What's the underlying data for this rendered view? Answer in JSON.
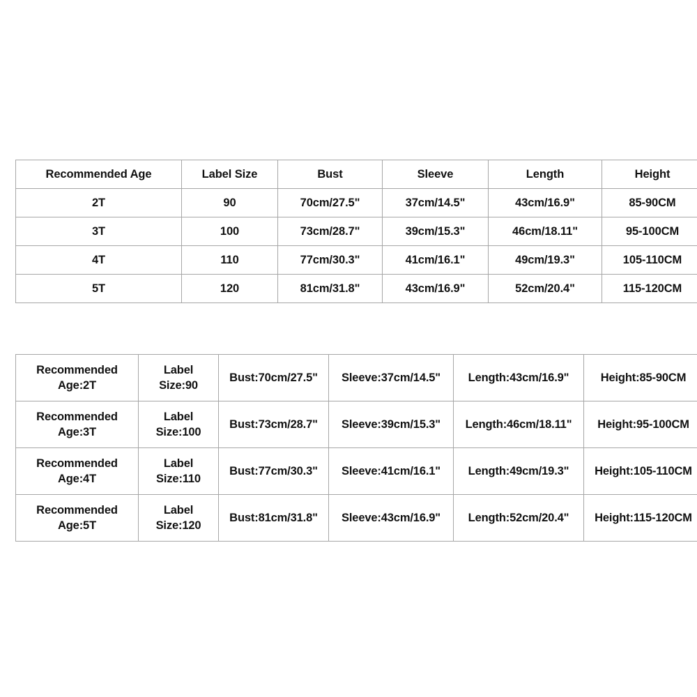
{
  "page": {
    "background_color": "#ffffff",
    "border_color": "#a6a6a6",
    "text_color": "#111111"
  },
  "table_columns": {
    "name": "size-chart-column-table",
    "headers": [
      "Recommended Age",
      "Label Size",
      "Bust",
      "Sleeve",
      "Length",
      "Height"
    ],
    "rows": [
      [
        "2T",
        "90",
        "70cm/27.5\"",
        "37cm/14.5\"",
        "43cm/16.9\"",
        "85-90CM"
      ],
      [
        "3T",
        "100",
        "73cm/28.7\"",
        "39cm/15.3\"",
        "46cm/18.11\"",
        "95-100CM"
      ],
      [
        "4T",
        "110",
        "77cm/30.3\"",
        "41cm/16.1\"",
        "49cm/19.3\"",
        "105-110CM"
      ],
      [
        "5T",
        "120",
        "81cm/31.8\"",
        "43cm/16.9\"",
        "52cm/20.4\"",
        "115-120CM"
      ]
    ]
  },
  "table_inline": {
    "name": "size-chart-inline-table",
    "rows": [
      {
        "age_line1": "Recommended",
        "age_line2": "Age:2T",
        "label_line1": "Label",
        "label_line2": "Size:90",
        "bust": "Bust:70cm/27.5\"",
        "sleeve": "Sleeve:37cm/14.5\"",
        "length": "Length:43cm/16.9\"",
        "height": "Height:85-90CM"
      },
      {
        "age_line1": "Recommended",
        "age_line2": "Age:3T",
        "label_line1": "Label",
        "label_line2": "Size:100",
        "bust": "Bust:73cm/28.7\"",
        "sleeve": "Sleeve:39cm/15.3\"",
        "length": "Length:46cm/18.11\"",
        "height": "Height:95-100CM"
      },
      {
        "age_line1": "Recommended",
        "age_line2": "Age:4T",
        "label_line1": "Label",
        "label_line2": "Size:110",
        "bust": "Bust:77cm/30.3\"",
        "sleeve": "Sleeve:41cm/16.1\"",
        "length": "Length:49cm/19.3\"",
        "height": "Height:105-110CM"
      },
      {
        "age_line1": "Recommended",
        "age_line2": "Age:5T",
        "label_line1": "Label",
        "label_line2": "Size:120",
        "bust": "Bust:81cm/31.8\"",
        "sleeve": "Sleeve:43cm/16.9\"",
        "length": "Length:52cm/20.4\"",
        "height": "Height:115-120CM"
      }
    ]
  }
}
